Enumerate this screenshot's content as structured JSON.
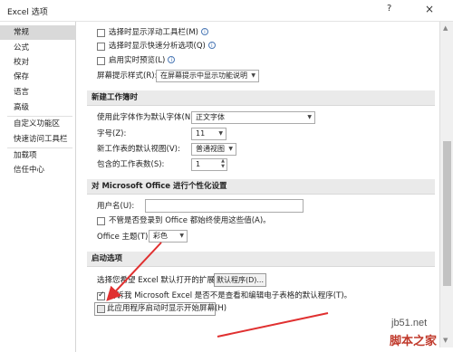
{
  "window": {
    "title": "Excel 选项",
    "help_icon": "?",
    "close_icon": "×"
  },
  "sidebar": {
    "items": [
      {
        "label": "常规"
      },
      {
        "label": "公式"
      },
      {
        "label": "校对"
      },
      {
        "label": "保存"
      },
      {
        "label": "语言"
      },
      {
        "label": "高级"
      },
      {
        "label": "自定义功能区"
      },
      {
        "label": "快速访问工具栏"
      },
      {
        "label": "加载项"
      },
      {
        "label": "信任中心"
      }
    ]
  },
  "general": {
    "mini_toolbar_label": "选择时显示浮动工具栏(M)",
    "quick_analysis_label": "选择时显示快速分析选项(Q)",
    "live_preview_label": "启用实时预览(L)",
    "screentip_label": "屏幕提示样式(R):",
    "screentip_value": "在屏幕提示中显示功能说明"
  },
  "new_workbook": {
    "heading": "新建工作簿时",
    "font_label": "使用此字体作为默认字体(N):",
    "font_value": "正文字体",
    "size_label": "字号(Z):",
    "size_value": "11",
    "view_label": "新工作表的默认视图(V):",
    "view_value": "普通视图",
    "sheets_label": "包含的工作表数(S):",
    "sheets_value": "1"
  },
  "personalize": {
    "heading": "对 Microsoft Office 进行个性化设置",
    "username_label": "用户名(U):",
    "username_value": "",
    "always_use_label": "不管是否登录到 Office 都始终使用这些值(A)。",
    "theme_label": "Office 主题(T):",
    "theme_value": "彩色"
  },
  "startup": {
    "heading": "启动选项",
    "extensions_label": "选择您希望 Excel 默认打开的扩展名:",
    "default_programs_button": "默认程序(D)...",
    "notify_label": "告诉我 Microsoft Excel 是否不是查看和编辑电子表格的默认程序(T)。",
    "start_screen_label": "此应用程序启动时显示开始屏幕(H)"
  },
  "watermark": {
    "line1": "jb51.net",
    "line2": "脚本之家"
  }
}
